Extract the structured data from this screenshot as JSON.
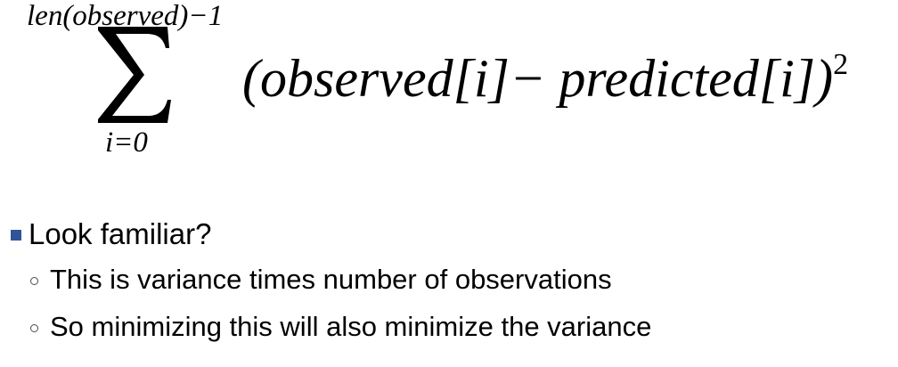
{
  "formula": {
    "upper_limit": "len(observed)−1",
    "lower_limit": "i=0",
    "summand_open": "(observed[i]− predicted[i])",
    "exponent": "2",
    "sigma_symbol": "∑"
  },
  "bullets": {
    "main": "Look familiar?",
    "sub": [
      "This is variance times number of observations",
      "So minimizing this will also minimize the variance"
    ]
  },
  "colors": {
    "bullet": "#2f5597",
    "text": "#000000"
  }
}
